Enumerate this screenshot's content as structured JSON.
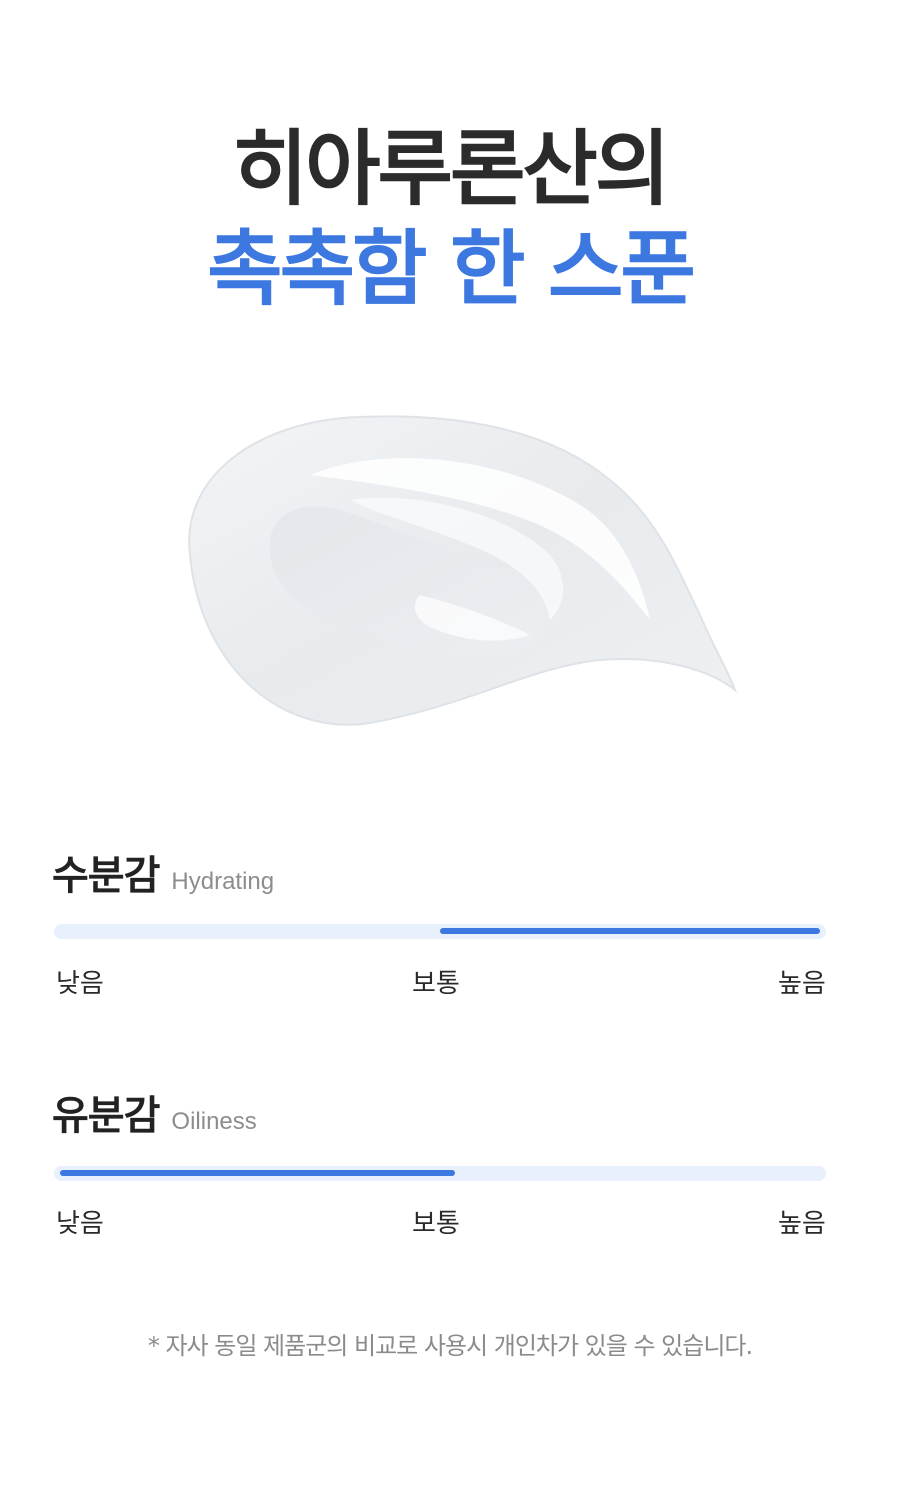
{
  "headline": {
    "line1": "히아루론산의",
    "line2": "촉촉함 한 스푼"
  },
  "colors": {
    "accent": "#3c78e0",
    "track": "#e7f0fc",
    "text": "#2a2a2a"
  },
  "meters": [
    {
      "title_ko": "수분감",
      "title_en": "Hydrating",
      "range_start": 0.5,
      "range_end": 1.0,
      "labels": {
        "low": "낮음",
        "mid": "보통",
        "high": "높음"
      }
    },
    {
      "title_ko": "유분감",
      "title_en": "Oiliness",
      "range_start": 0.0,
      "range_end": 0.52,
      "labels": {
        "low": "낮음",
        "mid": "보통",
        "high": "높음"
      }
    }
  ],
  "footnote": "* 자사 동일 제품군의 비교로 사용시 개인차가 있을 수 있습니다."
}
